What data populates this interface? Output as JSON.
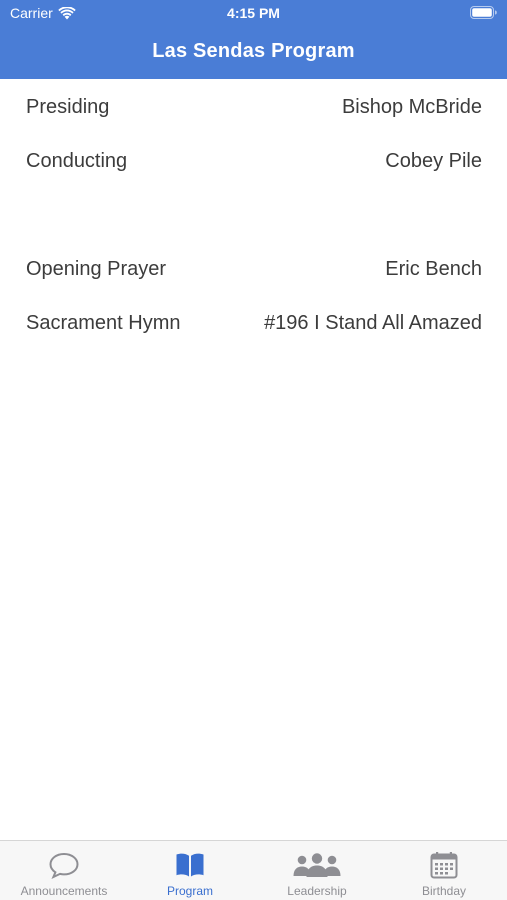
{
  "status_bar": {
    "carrier": "Carrier",
    "time": "4:15 PM"
  },
  "header": {
    "title": "Las Sendas Program",
    "background": "#4a7dd6"
  },
  "program": {
    "rows": [
      {
        "label": "Presiding",
        "value": "Bishop McBride"
      },
      {
        "label": "Conducting",
        "value": "Cobey Pile"
      },
      {
        "label": "Opening Prayer",
        "value": "Eric Bench"
      },
      {
        "label": "Sacrament Hymn",
        "value": "#196 I Stand All Amazed"
      }
    ]
  },
  "tabbar": {
    "active_color": "#3a6fcf",
    "inactive_color": "#8e8e93",
    "tabs": [
      {
        "label": "Announcements",
        "icon": "speech-bubble-icon"
      },
      {
        "label": "Program",
        "icon": "open-book-icon"
      },
      {
        "label": "Leadership",
        "icon": "people-icon"
      },
      {
        "label": "Birthday",
        "icon": "calendar-icon"
      }
    ]
  }
}
